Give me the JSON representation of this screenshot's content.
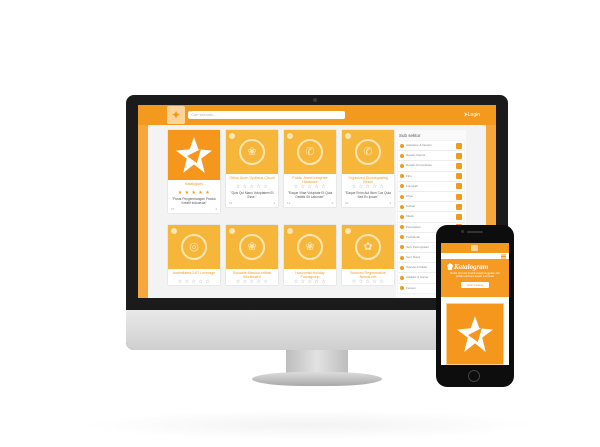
{
  "desktop": {
    "search_placeholder": "Cari sesuatu...",
    "login_label": "Login",
    "cards": [
      {
        "title": "Katalogues",
        "stars": "★ ★ ★ ★ ★",
        "desc": "\"Pusat Pengembangan Produk Kreatif Indonesia\"",
        "meta_left": "27",
        "meta_right": "4"
      },
      {
        "title": "Othos Arum Sydheus Circuit",
        "stars": "☆ ☆ ☆ ☆ ☆",
        "desc": "\"Quis Qui Manu Voluptatem Et Esse.\"",
        "meta_left": "12",
        "meta_right": "4"
      },
      {
        "title": "Public Jewel Integrate Hardware",
        "stars": "☆ ☆ ☆ ☆ ☆",
        "desc": "\"Eaque Vitae Voluptate Et Quia Debitis Sit Laborum\"",
        "meta_left": "12",
        "meta_right": "4"
      },
      {
        "title": "Organized Disintegrating Beam",
        "stars": "☆ ☆ ☆ ☆ ☆",
        "desc": "\"Eaque Enim Aut Illum Cus Quia Sed Ex Ipsum\"",
        "meta_left": "10",
        "meta_right": "4"
      },
      {
        "title": "Assimilated 24/7 Leverage",
        "stars": "☆ ☆ ☆ ☆ ☆",
        "desc": "",
        "meta_left": "",
        "meta_right": ""
      },
      {
        "title": "Sociable Mission-critical Workboard",
        "stars": "☆ ☆ ☆ ☆ ☆",
        "desc": "",
        "meta_left": "",
        "meta_right": ""
      },
      {
        "title": "Horizontal Holiday Focusgroup",
        "stars": "☆ ☆ ☆ ☆ ☆",
        "desc": "",
        "meta_left": "",
        "meta_right": ""
      },
      {
        "title": "Secured Regenerative Neural-net",
        "stars": "☆ ☆ ☆ ☆ ☆",
        "desc": "",
        "meta_left": "",
        "meta_right": ""
      }
    ],
    "sidebar": {
      "heading": "Sub sektor",
      "items": [
        "Arsitektur & Desain",
        "Desain Interior",
        "Desain Komunikasi",
        "Film",
        "Fotografi",
        "Kriya",
        "Kuliner",
        "Musik",
        "Penerbitan",
        "Periklanan",
        "Seni Pertunjukan",
        "Seni Rupa",
        "Televisi & Radio",
        "Aplikasi & Game",
        "Fesyen"
      ]
    }
  },
  "mobile": {
    "brand": "Katalogram",
    "tagline": "Media promosi produk kreatif unggulan dari pelaku ekonomi kreatif Indonesia",
    "button_label": "Lihat Katalog"
  },
  "colors": {
    "accent": "#f39a1e",
    "accent_light": "#f6b63a",
    "screen_bg": "#f3f3f3"
  }
}
